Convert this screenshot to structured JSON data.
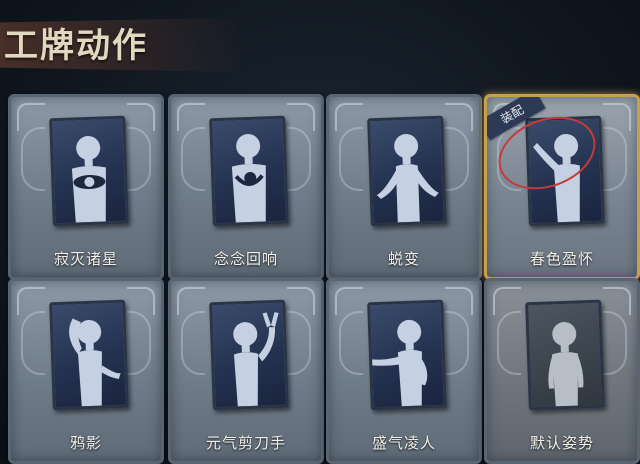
{
  "header": {
    "title": "工牌动作"
  },
  "cards": [
    {
      "label": "寂灭诸星",
      "pose": "crossed-hands"
    },
    {
      "label": "念念回响",
      "pose": "hug"
    },
    {
      "label": "蜕变",
      "pose": "open-arms"
    },
    {
      "label": "春色盈怀",
      "pose": "wave",
      "badge": "装配",
      "equipped": true
    },
    {
      "label": "鸦影",
      "pose": "salute"
    },
    {
      "label": "元气剪刀手",
      "pose": "peace-sign"
    },
    {
      "label": "盛气凌人",
      "pose": "point"
    },
    {
      "label": "默认姿势",
      "pose": "default"
    }
  ],
  "colors": {
    "equipped_border": "#c8a04a",
    "badge_bg": "#2c3a55",
    "mark": "#c73a3a"
  }
}
